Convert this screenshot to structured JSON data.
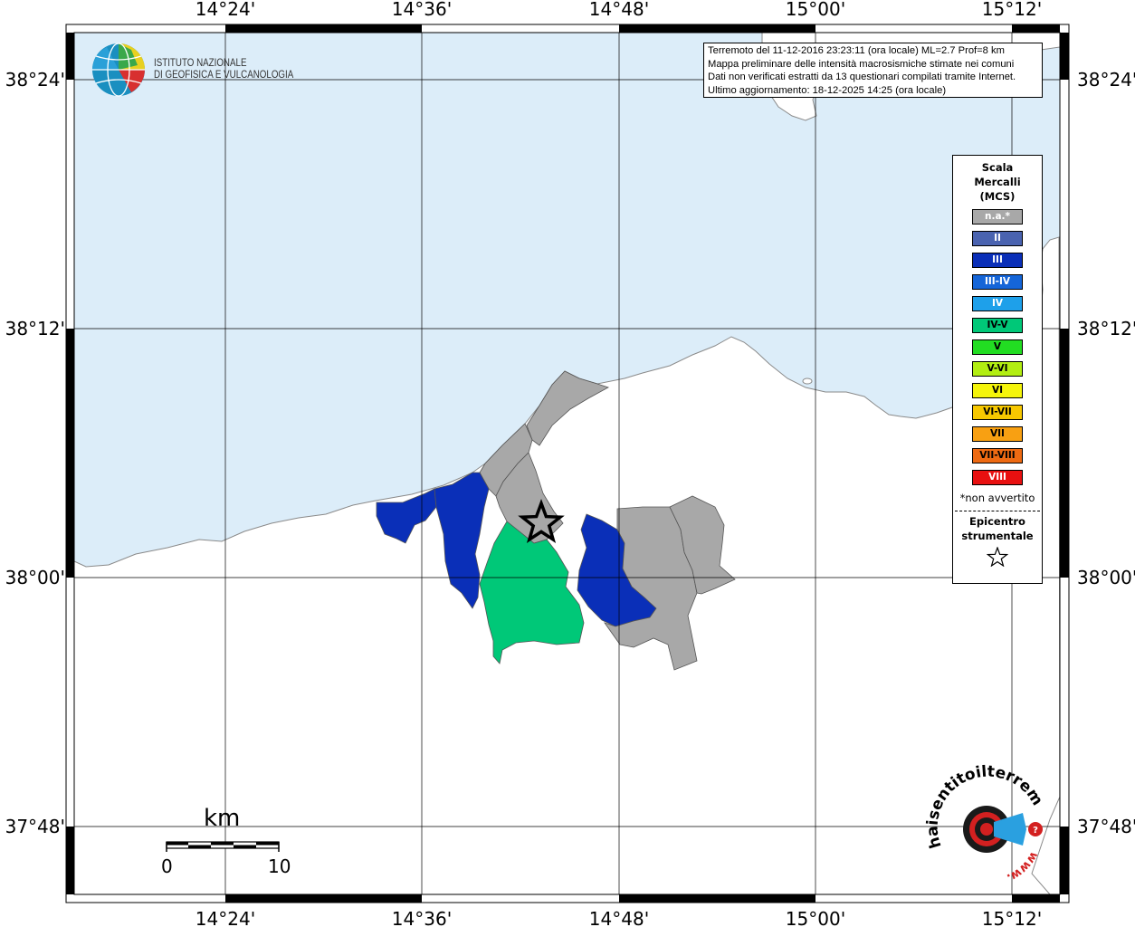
{
  "map": {
    "lon_labels": [
      "14°24'",
      "14°36'",
      "14°48'",
      "15°00'",
      "15°12'"
    ],
    "lat_labels": [
      "38°24'",
      "38°12'",
      "38°00'",
      "37°48'"
    ],
    "colors": {
      "sea": "#dcedf9",
      "land": "#ffffff",
      "grid": "#000000"
    }
  },
  "info": {
    "line1": "Terremoto del 11-12-2016 23:23:11 (ora locale) ML=2.7 Prof=8 km",
    "line2": "Mappa preliminare delle intensità macrosismiche stimate nei comuni",
    "line3": "Dati non verificati estratti da 13 questionari compilati tramite Internet.",
    "line4": "Ultimo aggiornamento: 18-12-2025 14:25 (ora locale)"
  },
  "logo": {
    "line1": "ISTITUTO NAZIONALE",
    "line2": "DI GEOFISICA E VULCANOLOGIA",
    "icon": "ingv-globe-icon"
  },
  "legend": {
    "title_line1": "Scala",
    "title_line2": "Mercalli",
    "title_line3": "(MCS)",
    "items": [
      {
        "label": "n.a.*",
        "color": "#a8a8a8",
        "text_color": "#ffffff"
      },
      {
        "label": "II",
        "color": "#4a63b0",
        "text_color": "#ffffff"
      },
      {
        "label": "III",
        "color": "#0a2fb8",
        "text_color": "#ffffff"
      },
      {
        "label": "III-IV",
        "color": "#1565d8",
        "text_color": "#ffffff"
      },
      {
        "label": "IV",
        "color": "#1ea0ea",
        "text_color": "#ffffff"
      },
      {
        "label": "IV-V",
        "color": "#00c878",
        "text_color": "#000000"
      },
      {
        "label": "V",
        "color": "#22dd22",
        "text_color": "#000000"
      },
      {
        "label": "V-VI",
        "color": "#b2ee12",
        "text_color": "#000000"
      },
      {
        "label": "VI",
        "color": "#f5f50a",
        "text_color": "#000000"
      },
      {
        "label": "VI-VII",
        "color": "#f7c800",
        "text_color": "#000000"
      },
      {
        "label": "VII",
        "color": "#f8a012",
        "text_color": "#000000"
      },
      {
        "label": "VII-VIII",
        "color": "#ee6a12",
        "text_color": "#000000"
      },
      {
        "label": "VIII",
        "color": "#e81010",
        "text_color": "#ffffff"
      }
    ],
    "note": "*non avvertito",
    "epicenter_line1": "Epicentro",
    "epicenter_line2": "strumentale",
    "epicenter_icon": "star-outline-icon"
  },
  "scalebar": {
    "title": "km",
    "start": "0",
    "end": "10"
  },
  "badge": {
    "text_top": "haisentitoilterremoto.it",
    "text_bottom": "www.",
    "icon": "target-megaphone-icon"
  }
}
